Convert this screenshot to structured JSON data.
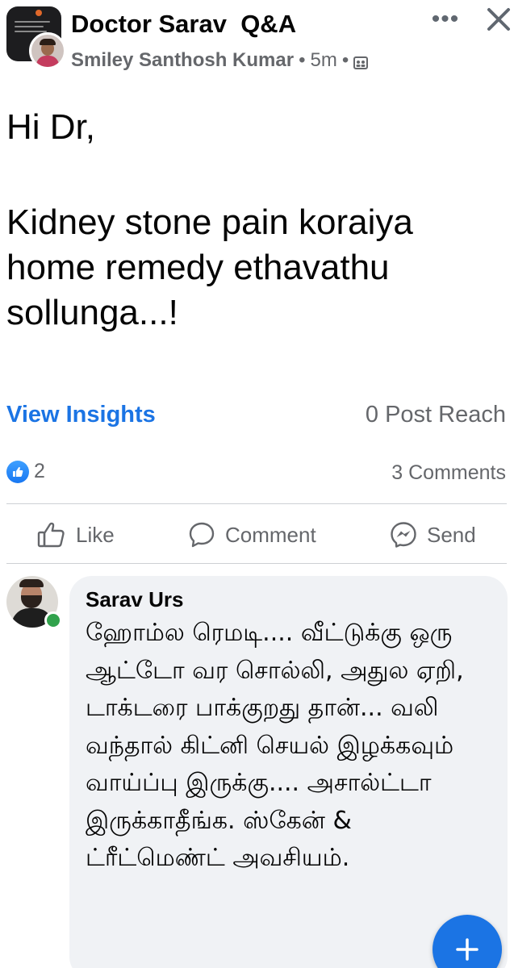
{
  "header": {
    "group_name": "Doctor Sarav  Q&A",
    "author": "Smiley Santhosh Kumar",
    "separator": "•",
    "time": "5m",
    "more_icon": "more-horizontal-icon",
    "more_label": "•••",
    "close_icon": "close-icon",
    "privacy_icon": "group-privacy-icon"
  },
  "post": {
    "lines": [
      "Hi Dr,",
      "Kidney stone pain koraiya home remedy ethavathu sollunga...!"
    ]
  },
  "insights": {
    "view_label": "View Insights",
    "reach_text": "0 Post Reach"
  },
  "reactions": {
    "icon": "like-reaction-icon",
    "count": "2",
    "comments_text": "3 Comments"
  },
  "actions": {
    "like": "Like",
    "comment": "Comment",
    "send": "Send"
  },
  "comment": {
    "author": "Sarav Urs",
    "text": "ஹோம்ல ரெமடி.... வீட்டுக்கு ஒரு ஆட்டோ வர சொல்லி, அதுல ஏறி, டாக்டரை பாக்குறது தான்... வலி வந்தால் கிட்னி செயல் இழக்கவும் வாய்ப்பு இருக்கு.... அசால்ட்டா இருக்காதீங்க. ஸ்கேன் & ட்ரீட்மெண்ட் அவசியம்.",
    "online": true
  },
  "fab": {
    "icon": "plus-icon"
  },
  "colors": {
    "accent": "#1b74e4",
    "secondary_text": "#65676b",
    "bubble": "#f0f2f5",
    "online": "#31a24c"
  }
}
